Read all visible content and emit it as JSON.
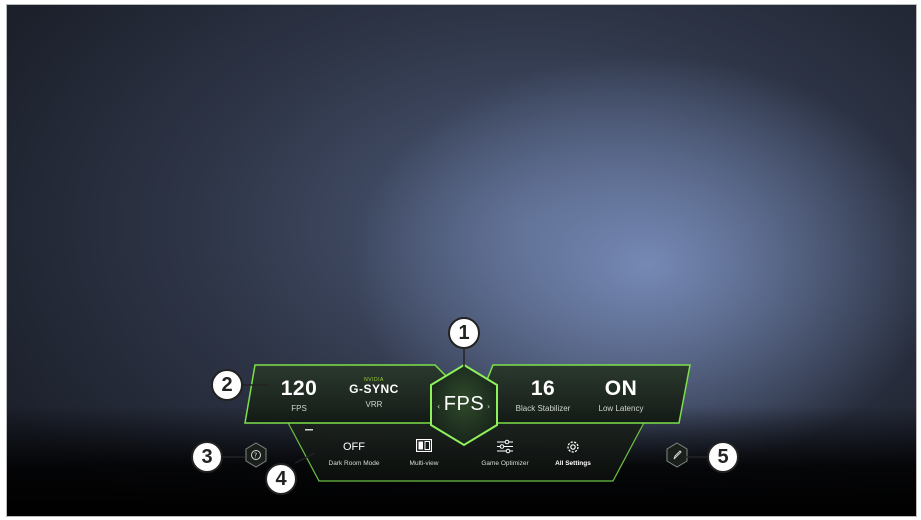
{
  "center": {
    "label": "FPS"
  },
  "stats_left": [
    {
      "value": "120",
      "label": "FPS"
    },
    {
      "value": "G-SYNC",
      "brand": "NVIDIA",
      "label": "VRR"
    }
  ],
  "stats_right": [
    {
      "value": "16",
      "label": "Black Stabilizer"
    },
    {
      "value": "ON",
      "label": "Low Latency"
    }
  ],
  "tools": [
    {
      "value": "OFF",
      "label": "Dark Room Mode"
    },
    {
      "icon": "multi-view-icon",
      "label": "Multi-view"
    },
    {
      "icon": "sliders-icon",
      "label": "Game Optimizer"
    },
    {
      "icon": "gear-icon",
      "label": "All Settings"
    }
  ],
  "left_button": {
    "icon": "help-icon"
  },
  "right_button": {
    "icon": "pencil-icon"
  },
  "callouts": [
    "1",
    "2",
    "3",
    "4",
    "5"
  ],
  "colors": {
    "accent": "#7de04a",
    "panel": "#1f2a22"
  }
}
